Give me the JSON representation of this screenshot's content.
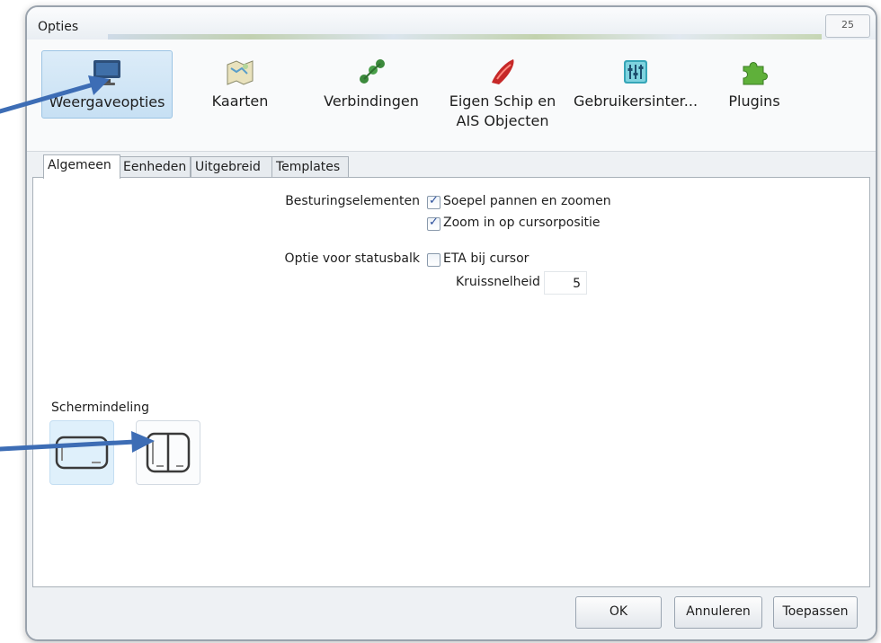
{
  "window": {
    "title": "Opties",
    "close_label": "25"
  },
  "toolbar": {
    "items": [
      {
        "label": "Weergaveopties",
        "icon": "monitor-icon",
        "selected": true
      },
      {
        "label": "Kaarten",
        "icon": "map-icon",
        "selected": false
      },
      {
        "label": "Verbindingen",
        "icon": "connections-icon",
        "selected": false
      },
      {
        "label_line1": "Eigen Schip en",
        "label_line2": "AIS Objecten",
        "icon": "ship-icon",
        "selected": false
      },
      {
        "label": "Gebruikersinter...",
        "icon": "sliders-icon",
        "selected": false
      },
      {
        "label": "Plugins",
        "icon": "puzzle-icon",
        "selected": false
      }
    ]
  },
  "tabs": [
    {
      "label": "Algemeen",
      "active": true
    },
    {
      "label": "Eenheden",
      "active": false
    },
    {
      "label": "Uitgebreid",
      "active": false
    },
    {
      "label": "Templates",
      "active": false
    }
  ],
  "settings": {
    "controls_label": "Besturingselementen",
    "smooth_pan_label": "Soepel pannen en zoomen",
    "smooth_pan_checked": true,
    "zoom_cursor_label": "Zoom in op cursorpositie",
    "zoom_cursor_checked": true,
    "statusbar_label": "Optie voor statusbalk",
    "eta_label": "ETA bij cursor",
    "eta_checked": false,
    "cruise_speed_label": "Kruissnelheid",
    "cruise_speed_value": "5"
  },
  "screen_layout": {
    "title": "Schermindeling",
    "options": [
      "single-pane-layout",
      "split-vertical-layout"
    ],
    "selected": "single-pane-layout"
  },
  "footer": {
    "ok_label": "OK",
    "cancel_label": "Annuleren",
    "apply_label": "Toepassen"
  },
  "colors": {
    "arrow": "#3d6db5",
    "selection": "#c7e0f4",
    "check": "#2a4e9a"
  }
}
